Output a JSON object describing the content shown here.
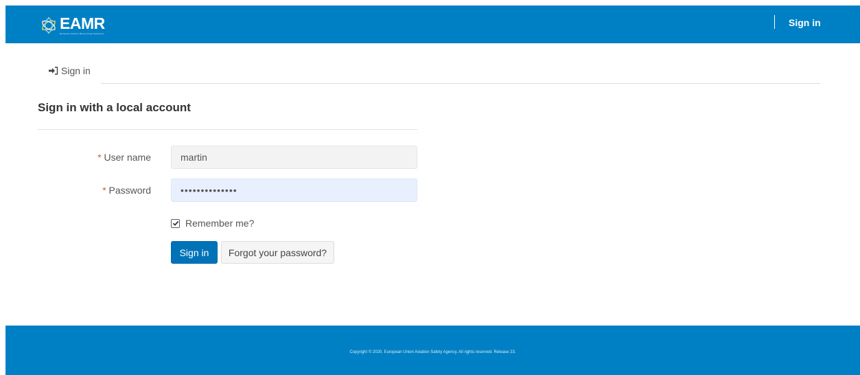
{
  "navbar": {
    "logo_text": "EAMR",
    "logo_subtext": "European Aviation Meteorology Repository",
    "signin_label": "Sign in"
  },
  "tabs": [
    {
      "label": "Sign in",
      "icon": "sign-in-icon"
    }
  ],
  "form": {
    "heading": "Sign in with a local account",
    "required_marker": "*",
    "username_label": "User name",
    "username_value": "martin",
    "password_label": "Password",
    "password_value": "••••••••••••••",
    "remember_label": "Remember me?",
    "remember_checked": true,
    "submit_label": "Sign in",
    "forgot_label": "Forgot your password?"
  },
  "footer": {
    "text": "Copyright © 2020. European Union Aviation Safety Agency. All rights reserved. Release 23."
  },
  "colors": {
    "brand_blue": "#0080c4",
    "primary_button": "#0073b7",
    "required_red": "#d9534f"
  }
}
